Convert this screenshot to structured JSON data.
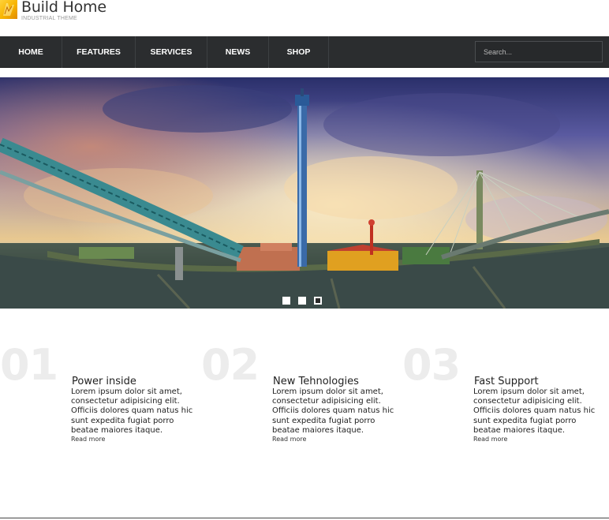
{
  "brand": {
    "title": "Build Home",
    "subtitle": "INDUSTRIAL THEME"
  },
  "nav": {
    "items": [
      {
        "label": "HOME"
      },
      {
        "label": "FEATURES"
      },
      {
        "label": "SERVICES"
      },
      {
        "label": "NEWS"
      },
      {
        "label": "SHOP"
      }
    ],
    "search_placeholder": "Search..."
  },
  "hero": {
    "image": "hdr-photo-bridges-tower-harbor",
    "slides": 3,
    "active_slide": 3
  },
  "features": [
    {
      "number": "01",
      "title": "Power inside",
      "text": "Lorem ipsum dolor sit amet, consectetur adipisicing elit. Officiis dolores quam natus hic sunt expedita fugiat porro beatae maiores itaque.",
      "link": "Read more"
    },
    {
      "number": "02",
      "title": "New Tehnologies",
      "text": "Lorem ipsum dolor sit amet, consectetur adipisicing elit. Officiis dolores quam natus hic sunt expedita fugiat porro beatae maiores itaque.",
      "link": "Read more"
    },
    {
      "number": "03",
      "title": "Fast Support",
      "text": "Lorem ipsum dolor sit amet, consectetur adipisicing elit. Officiis dolores quam natus hic sunt expedita fugiat porro beatae maiores itaque.",
      "link": "Read more"
    }
  ],
  "colors": {
    "navbar": "#2b2d2f",
    "logo": "#f7b300",
    "number": "#ececec"
  }
}
